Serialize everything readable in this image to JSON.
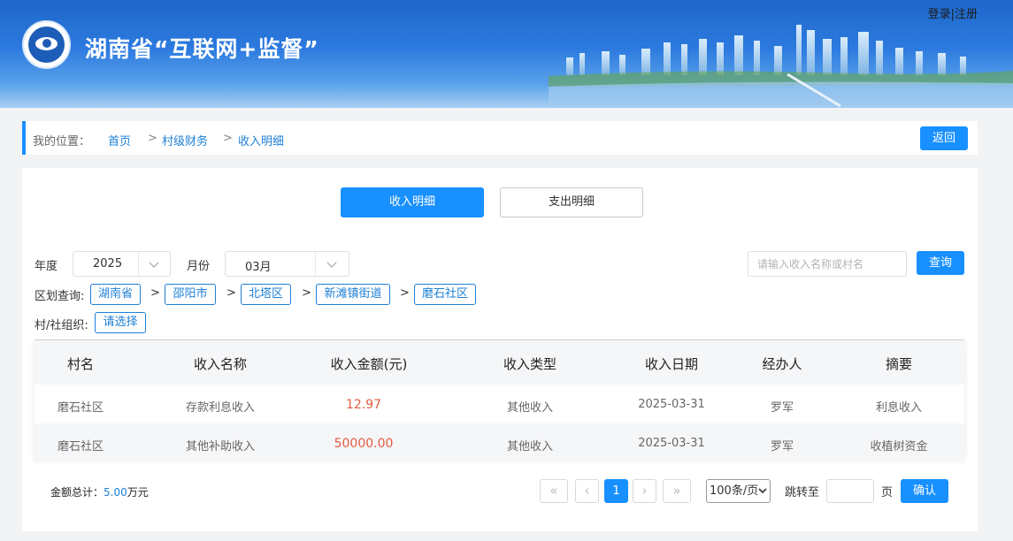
{
  "header": {
    "site_title": "湖南省“互联网+监督”",
    "login": "登录",
    "divider": "|",
    "register": "注册"
  },
  "breadcrumb": {
    "prefix": "我的位置：",
    "items": [
      "首页",
      "村级财务",
      "收入明细"
    ],
    "separator": ">",
    "back_label": "返回"
  },
  "tabs": [
    {
      "label": "收入明细",
      "active": true
    },
    {
      "label": "支出明细",
      "active": false
    }
  ],
  "filters": {
    "year_label": "年度",
    "year_value": "2025",
    "month_label": "月份",
    "month_value": "03月",
    "search_placeholder": "请输入收入名称或村名",
    "query_label": "查询",
    "region_label": "区划查询:",
    "region_chips": [
      "湖南省",
      "邵阳市",
      "北塔区",
      "新滩镇街道",
      "磨石社区"
    ],
    "region_sep": ">",
    "org_label": "村/社组织:",
    "org_chip": "请选择"
  },
  "table": {
    "columns": [
      "村名",
      "收入名称",
      "收入金额(元)",
      "收入类型",
      "收入日期",
      "经办人",
      "摘要"
    ],
    "rows": [
      [
        "磨石社区",
        "存款利息收入",
        "12.97",
        "其他收入",
        "2025-03-31",
        "罗军",
        "利息收入"
      ],
      [
        "磨石社区",
        "其他补助收入",
        "50000.00",
        "其他收入",
        "2025-03-31",
        "罗军",
        "收植树资金"
      ]
    ]
  },
  "footer": {
    "total_label": "金额总计：",
    "total_value": "5.00",
    "total_unit": "万元",
    "first_page": "«",
    "prev_page": "‹",
    "current_page": "1",
    "next_page": "›",
    "last_page": "»",
    "page_size": "100条/页",
    "jump_label": "跳转至",
    "page_unit": "页",
    "confirm_label": "确认"
  },
  "colors": {
    "primary": "#1890ff",
    "link": "#1e80d6",
    "amount": "#e25b3f",
    "header_top": "#1f67c9"
  }
}
